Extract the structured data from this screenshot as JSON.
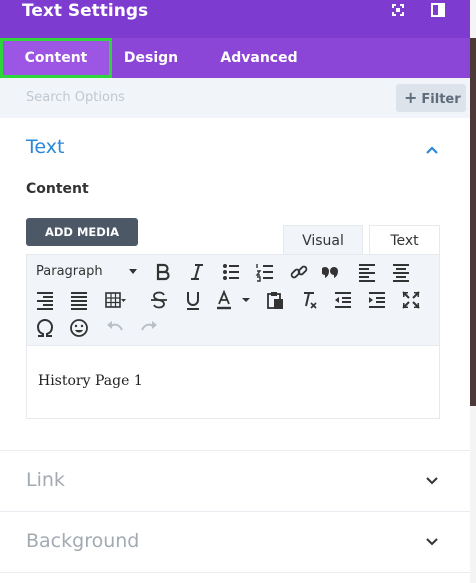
{
  "header": {
    "title": "Text Settings"
  },
  "tabs": [
    {
      "label": "Content"
    },
    {
      "label": "Design"
    },
    {
      "label": "Advanced"
    }
  ],
  "search": {
    "placeholder": "Search Options",
    "filter_label": "Filter"
  },
  "text_section": {
    "title": "Text",
    "content_label": "Content",
    "add_media_label": "ADD MEDIA",
    "editor_tabs": {
      "visual": "Visual",
      "text": "Text"
    },
    "format_select": "Paragraph",
    "editor_content": "History Page 1"
  },
  "collapsed_sections": [
    {
      "title": "Link"
    },
    {
      "title": "Background"
    }
  ],
  "colors": {
    "header": "#7e3bd0",
    "tabbar": "#8b46d8",
    "active_outline": "#2fd63b",
    "accent": "#2b87da"
  }
}
